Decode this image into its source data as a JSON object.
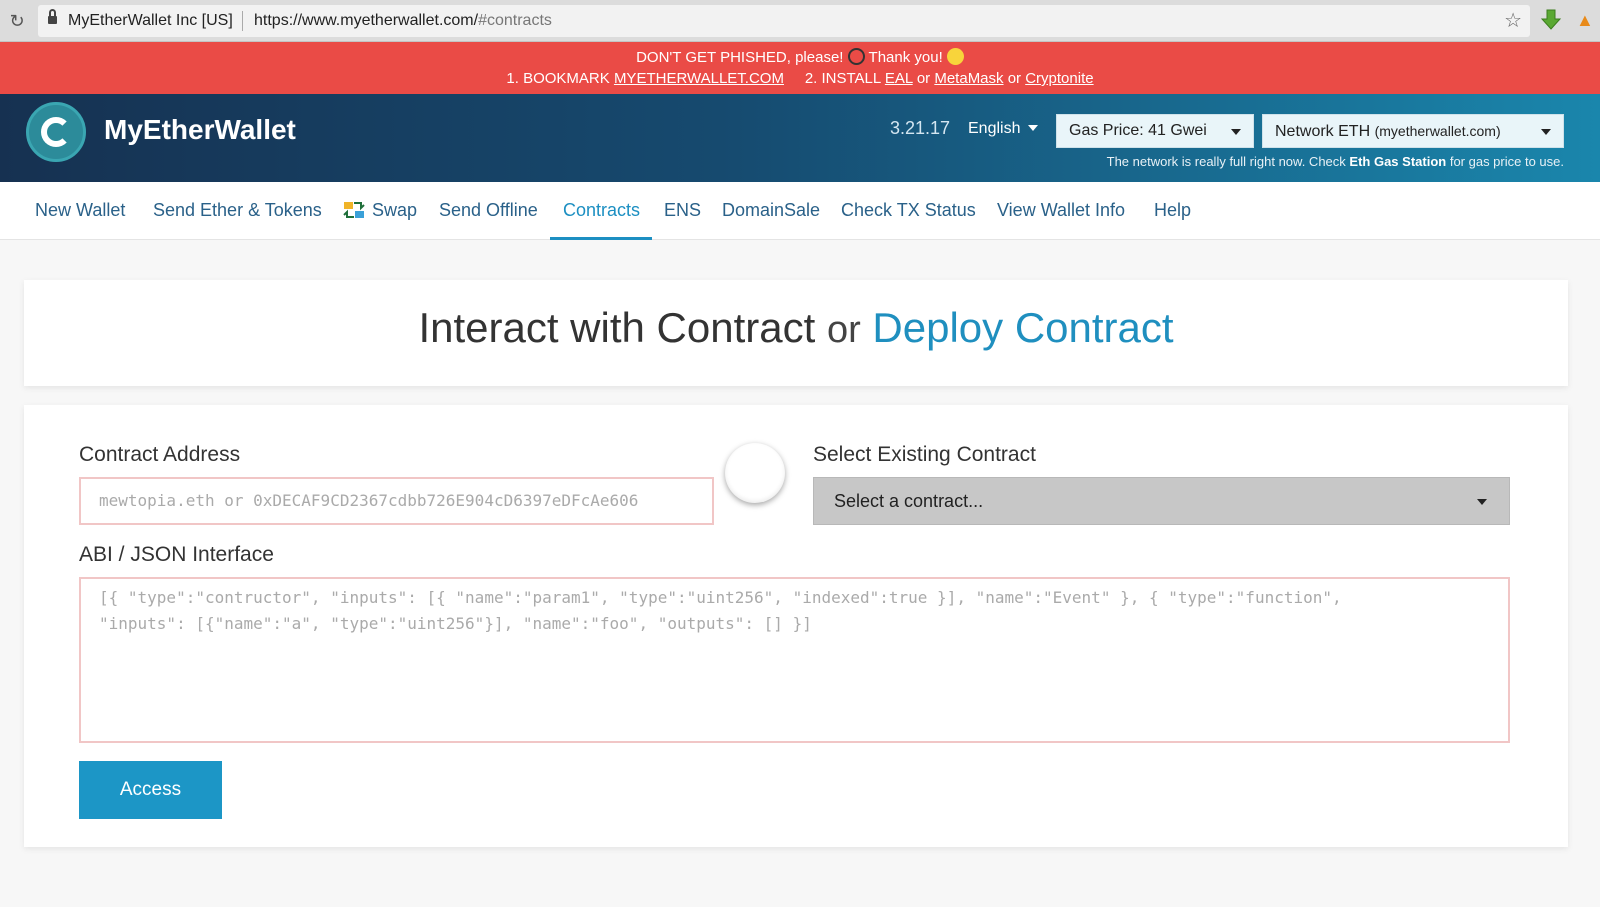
{
  "browser": {
    "org": "MyEtherWallet Inc [US]",
    "url_main": "https://www.myetherwallet.com/",
    "url_hash": "#contracts"
  },
  "phishing": {
    "line1_a": "DON'T GET PHISHED, please!",
    "line1_b": "Thank you!",
    "l2_prefix": "1. BOOKMARK",
    "l2_bookmark": "MYETHERWALLET.COM",
    "l2_install": "2. INSTALL",
    "l2_eal": "EAL",
    "l2_or1": "or",
    "l2_metamask": "MetaMask",
    "l2_or2": "or",
    "l2_cryptonite": "Cryptonite"
  },
  "header": {
    "brand": "MyEtherWallet",
    "version": "3.21.17",
    "language": "English",
    "gas_price": "Gas Price: 41 Gwei",
    "network_main": "Network ETH",
    "network_host": "(myetherwallet.com)",
    "gas_note_a": "The network is really full right now. Check",
    "gas_note_link": "Eth Gas Station",
    "gas_note_b": "for gas price to use."
  },
  "nav": {
    "items": [
      "New Wallet",
      "Send Ether & Tokens",
      "Swap",
      "Send Offline",
      "Contracts",
      "ENS",
      "DomainSale",
      "Check TX Status",
      "View Wallet Info",
      "Help"
    ],
    "active": "Contracts"
  },
  "title": {
    "interact": "Interact with Contract",
    "or": "or",
    "deploy": "Deploy Contract"
  },
  "form": {
    "address_label": "Contract Address",
    "address_placeholder": "mewtopia.eth or 0xDECAF9CD2367cdbb726E904cD6397eDFcAe606",
    "existing_label": "Select Existing Contract",
    "select_value": "Select a contract...",
    "abi_label": "ABI / JSON Interface",
    "abi_placeholder": "[{ \"type\":\"contructor\", \"inputs\": [{ \"name\":\"param1\", \"type\":\"uint256\", \"indexed\":true }], \"name\":\"Event\" }, { \"type\":\"function\",\n\"inputs\": [{\"name\":\"a\", \"type\":\"uint256\"}], \"name\":\"foo\", \"outputs\": [] }]",
    "access_label": "Access"
  },
  "colors": {
    "phish_bg": "#ea4b46",
    "accent": "#1c8fc2",
    "access_bg": "#1c96c6"
  }
}
